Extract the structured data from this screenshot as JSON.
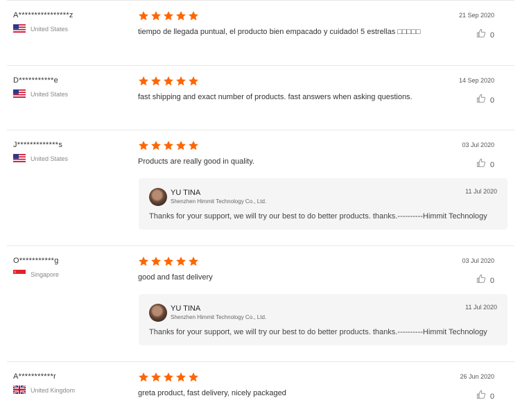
{
  "colors": {
    "star": "#ff6600",
    "divider": "#e8e8e8",
    "reply_bg": "#f5f5f5"
  },
  "icons": {
    "star": "star-icon",
    "thumb": "thumbs-up-icon"
  },
  "reviews": [
    {
      "user": "A****************z",
      "country": "United States",
      "flag": "us",
      "rating": 5,
      "text": "tiempo de llegada puntual, el producto bien empacado y cuidado! 5 estrellas □□□□□",
      "date": "21 Sep 2020",
      "helpful": "0"
    },
    {
      "user": "D***********e",
      "country": "United States",
      "flag": "us",
      "rating": 5,
      "text": "fast shipping and exact number of products. fast answers when asking questions.",
      "date": "14 Sep 2020",
      "helpful": "0"
    },
    {
      "user": "J*************s",
      "country": "United States",
      "flag": "us",
      "rating": 5,
      "text": "Products are really good in quality.",
      "date": "03 Jul 2020",
      "helpful": "0",
      "reply": {
        "name": "YU TINA",
        "company": "Shenzhen Himmit Technology Co., Ltd.",
        "date": "11 Jul 2020",
        "text": "Thanks for your support, we will try our best to do better products. thanks.----------Himmit Technology"
      }
    },
    {
      "user": "O***********g",
      "country": "Singapore",
      "flag": "sg",
      "rating": 5,
      "text": "good and fast delivery",
      "date": "03 Jul 2020",
      "helpful": "0",
      "reply": {
        "name": "YU TINA",
        "company": "Shenzhen Himmit Technology Co., Ltd.",
        "date": "11 Jul 2020",
        "text": "Thanks for your support, we will try our best to do better products. thanks.----------Himmit Technology"
      }
    },
    {
      "user": "A***********r",
      "country": "United Kingdom",
      "flag": "uk",
      "rating": 5,
      "text": "greta product, fast delivery, nicely packaged",
      "date": "26 Jun 2020",
      "helpful": "0"
    }
  ]
}
